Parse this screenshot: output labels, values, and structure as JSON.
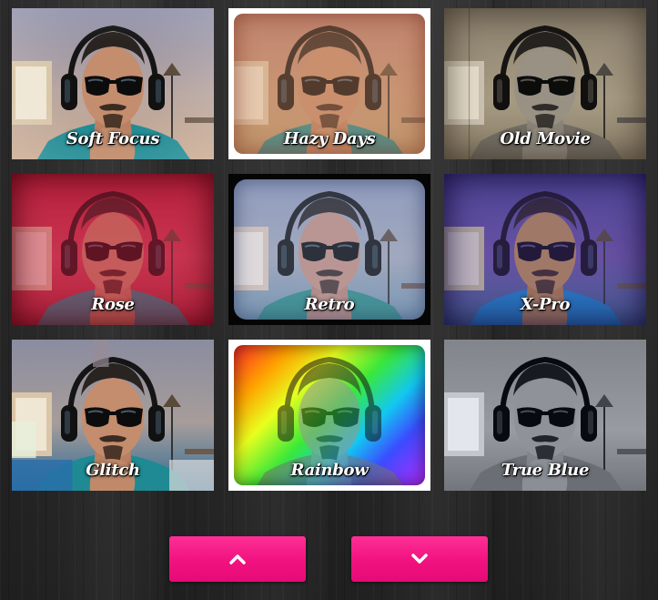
{
  "filters": [
    {
      "label": "Soft Focus"
    },
    {
      "label": "Hazy Days"
    },
    {
      "label": "Old Movie"
    },
    {
      "label": "Rose"
    },
    {
      "label": "Retro"
    },
    {
      "label": "X-Pro"
    },
    {
      "label": "Glitch"
    },
    {
      "label": "Rainbow"
    },
    {
      "label": "True Blue"
    }
  ],
  "navigation": {
    "up_icon": "chevron-up-icon",
    "down_icon": "chevron-down-icon"
  },
  "colors": {
    "button_accent": "#f0127f",
    "label_text": "#ffffff"
  }
}
